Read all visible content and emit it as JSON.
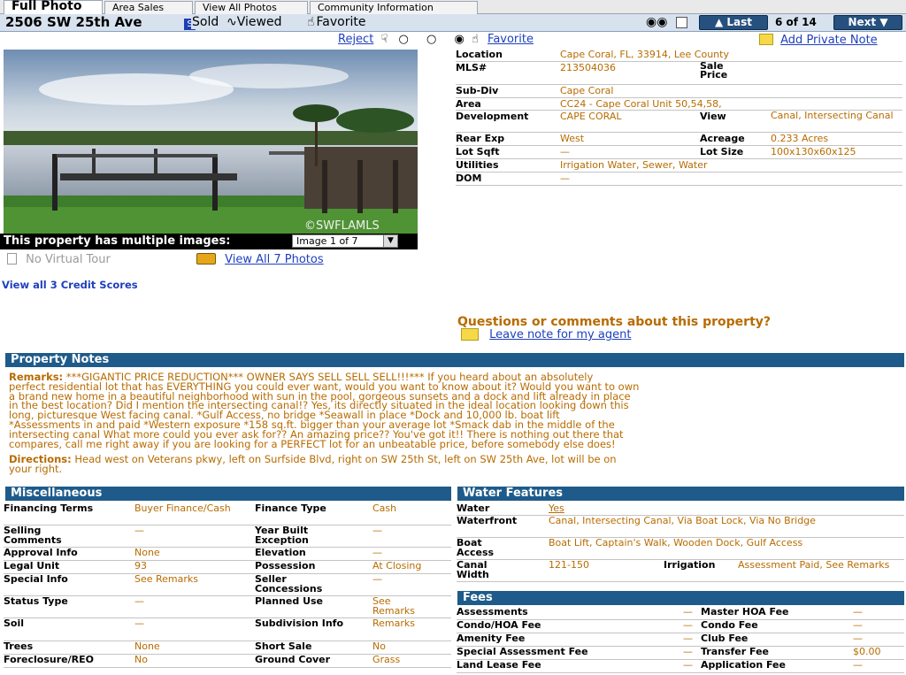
{
  "tabs": [
    "Full Photo",
    "Area Sales",
    "View All Photos",
    "Community Information"
  ],
  "title": {
    "address": "2506 SW 25th Ave",
    "sold": "Sold",
    "viewed": "Viewed",
    "favorite": "Favorite",
    "last": "Last",
    "counter": "6 of 14",
    "next": "Next"
  },
  "rating": {
    "reject": "Reject",
    "favorite": "Favorite",
    "private_note": "Add Private Note"
  },
  "photo": {
    "watermark": "©SWFLAMLS",
    "multiple_images": "This property has multiple images:",
    "image_select": "Image 1 of 7",
    "no_virtual_tour": "No Virtual Tour",
    "view_all_photos": "View All 7 Photos",
    "credit_scores": "View all 3 Credit Scores"
  },
  "details": {
    "location_label": "Location",
    "location": "Cape Coral, FL, 33914, Lee County",
    "mls_label": "MLS#",
    "mls": "213504036",
    "sale_price_label": "Sale Price",
    "sale_price": "",
    "subdiv_label": "Sub-Div",
    "subdiv": "Cape Coral",
    "area_label": "Area",
    "area": "CC24 - Cape Coral Unit 50,54,58,",
    "development_label": "Development",
    "development": "CAPE CORAL",
    "view_label": "View",
    "view": "Canal, Intersecting Canal",
    "rear_exp_label": "Rear Exp",
    "rear_exp": "West",
    "acreage_label": "Acreage",
    "acreage": "0.233 Acres",
    "lot_sqft_label": "Lot Sqft",
    "lot_sqft": "—",
    "lot_size_label": "Lot Size",
    "lot_size": "100x130x60x125",
    "utilities_label": "Utilities",
    "utilities": "Irrigation Water, Sewer, Water",
    "dom_label": "DOM",
    "dom": "—"
  },
  "questions": {
    "heading": "Questions or comments about this property?",
    "link": "Leave note for my agent"
  },
  "property_notes": {
    "heading": "Property Notes",
    "remarks_label": "Remarks:",
    "remarks_lines": [
      "***GIGANTIC PRICE REDUCTION*** OWNER SAYS SELL SELL SELL!!!*** If you heard about an absolutely",
      "perfect residential lot that has EVERYTHING you could ever want, would you want to know about it? Would you want to own",
      "a brand new home in a beautiful neighborhood with sun in the pool, gorgeous sunsets and a dock and lift already in place",
      "in the best location? Did I mention the intersecting canal!? Yes, its directly situated in the ideal location looking down this",
      "long, picturesque West facing canal. *Gulf Access, no bridge *Seawall in place *Dock and 10,000 lb. boat lift",
      "*Assessments in and paid *Western exposure *158 sq.ft. bigger than your average lot *Smack dab in the middle of the",
      "intersecting canal What more could you ever ask for?? An amazing price?? You've got it!! There is nothing out there that",
      "compares, call me right away if you are looking for a PERFECT lot for an unbeatable price, before somebody else does!"
    ],
    "directions_label": "Directions:",
    "directions_lines": [
      "Head west on Veterans pkwy, left on Surfside Blvd, right on SW 25th St, left on SW 25th Ave, lot will be on",
      "your right."
    ]
  },
  "misc": {
    "heading": "Miscellaneous",
    "rows": [
      [
        "Financing Terms",
        "Buyer Finance/Cash",
        "Finance Type",
        "Cash"
      ],
      [
        "Selling Comments",
        "—",
        "Year Built Exception",
        "—"
      ],
      [
        "Approval Info",
        "None",
        "Elevation",
        "—"
      ],
      [
        "Legal Unit",
        "93",
        "Possession",
        "At Closing"
      ],
      [
        "Special Info",
        "See Remarks",
        "Seller Concessions",
        "—"
      ],
      [
        "Status Type",
        "—",
        "Planned Use",
        "See Remarks"
      ],
      [
        "Soil",
        "—",
        "Subdivision Info",
        "Remarks"
      ],
      [
        "Trees",
        "None",
        "Short Sale",
        "No"
      ],
      [
        "Foreclosure/REO",
        "No",
        "Ground Cover",
        "Grass"
      ]
    ]
  },
  "water": {
    "heading": "Water Features",
    "water_label": "Water",
    "water": "Yes",
    "waterfront_label": "Waterfront",
    "waterfront": "Canal, Intersecting Canal, Via Boat Lock, Via No Bridge",
    "boat_label": "Boat Access",
    "boat": "Boat Lift, Captain's Walk, Wooden Dock, Gulf Access",
    "canal_label": "Canal Width",
    "canal": "121-150",
    "irrigation_label": "Irrigation",
    "irrigation": "Assessment Paid, See Remarks"
  },
  "fees": {
    "heading": "Fees",
    "rows": [
      [
        "Assessments",
        "—",
        "Master HOA Fee",
        "—"
      ],
      [
        "Condo/HOA Fee",
        "—",
        "Condo Fee",
        "—"
      ],
      [
        "Amenity Fee",
        "—",
        "Club Fee",
        "—"
      ],
      [
        "Special Assessment Fee",
        "—",
        "Transfer Fee",
        "$0.00"
      ],
      [
        "Land Lease Fee",
        "—",
        "Application Fee",
        "—"
      ]
    ]
  }
}
